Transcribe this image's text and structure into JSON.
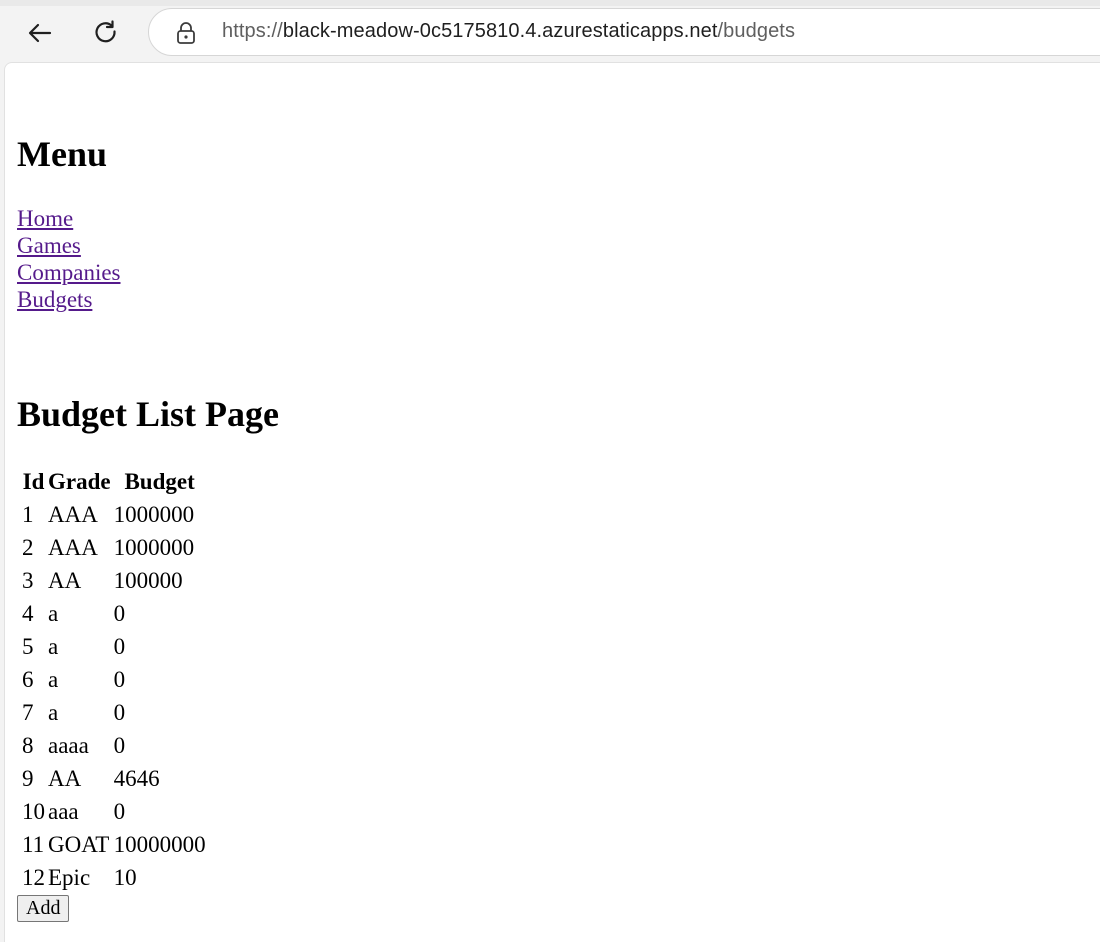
{
  "browser": {
    "url_protocol": "https://",
    "url_host": "black-meadow-0c5175810.4.azurestaticapps.net",
    "url_path": "/budgets"
  },
  "menu": {
    "title": "Menu",
    "links": [
      "Home",
      "Games",
      "Companies",
      "Budgets"
    ]
  },
  "page": {
    "title": "Budget List Page"
  },
  "table": {
    "headers": [
      "Id",
      "Grade",
      "Budget"
    ],
    "rows": [
      [
        "1",
        "AAA",
        "1000000"
      ],
      [
        "2",
        "AAA",
        "1000000"
      ],
      [
        "3",
        "AA",
        "100000"
      ],
      [
        "4",
        "a",
        "0"
      ],
      [
        "5",
        "a",
        "0"
      ],
      [
        "6",
        "a",
        "0"
      ],
      [
        "7",
        "a",
        "0"
      ],
      [
        "8",
        "aaaa",
        "0"
      ],
      [
        "9",
        "AA",
        "4646"
      ],
      [
        "10",
        "aaa",
        "0"
      ],
      [
        "11",
        "GOAT",
        "10000000"
      ],
      [
        "12",
        "Epic",
        "10"
      ]
    ]
  },
  "add_button_label": "Add"
}
